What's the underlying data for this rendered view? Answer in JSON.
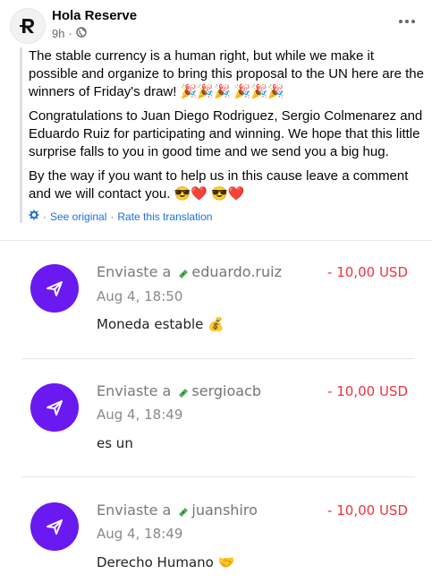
{
  "post": {
    "author": "Hola Reserve",
    "time": "9h",
    "paragraphs": [
      "The stable currency is a human right, but while we make it possible and organize to bring this proposal to the UN here are the winners of Friday's draw! 🎉🎉🎉 🎉🎉🎉",
      "Congratulations to Juan Diego Rodriguez, Sergio Colmenarez and Eduardo Ruiz for participating and winning. We hope that this little surprise falls to you in good time and we send you a big hug.",
      "By the way if you want to help us in this cause leave a comment and we will contact you. 😎❤️ 😎❤️"
    ],
    "translation": {
      "see_original": "See original",
      "separator": "·",
      "rate": "Rate this translation"
    }
  },
  "transactions": [
    {
      "prefix": "Enviaste a",
      "user": "eduardo.ruiz",
      "date": "Aug 4, 18:50",
      "memo": "Moneda estable 💰",
      "amount": "- 10,00 USD"
    },
    {
      "prefix": "Enviaste a",
      "user": "sergioacb",
      "date": "Aug 4, 18:49",
      "memo": "es un",
      "amount": "- 10,00 USD"
    },
    {
      "prefix": "Enviaste a",
      "user": "juanshiro",
      "date": "Aug 4, 18:49",
      "memo": "Derecho Humano 🤝",
      "amount": "- 10,00 USD"
    }
  ],
  "colors": {
    "accent_purple": "#6a19f0",
    "amount_red": "#ef3340",
    "link_blue": "#216fdb"
  },
  "icons": [
    "hola-reserve-logo-icon",
    "globe-icon",
    "more-options-icon",
    "gear-icon",
    "send-icon",
    "money-icon"
  ]
}
